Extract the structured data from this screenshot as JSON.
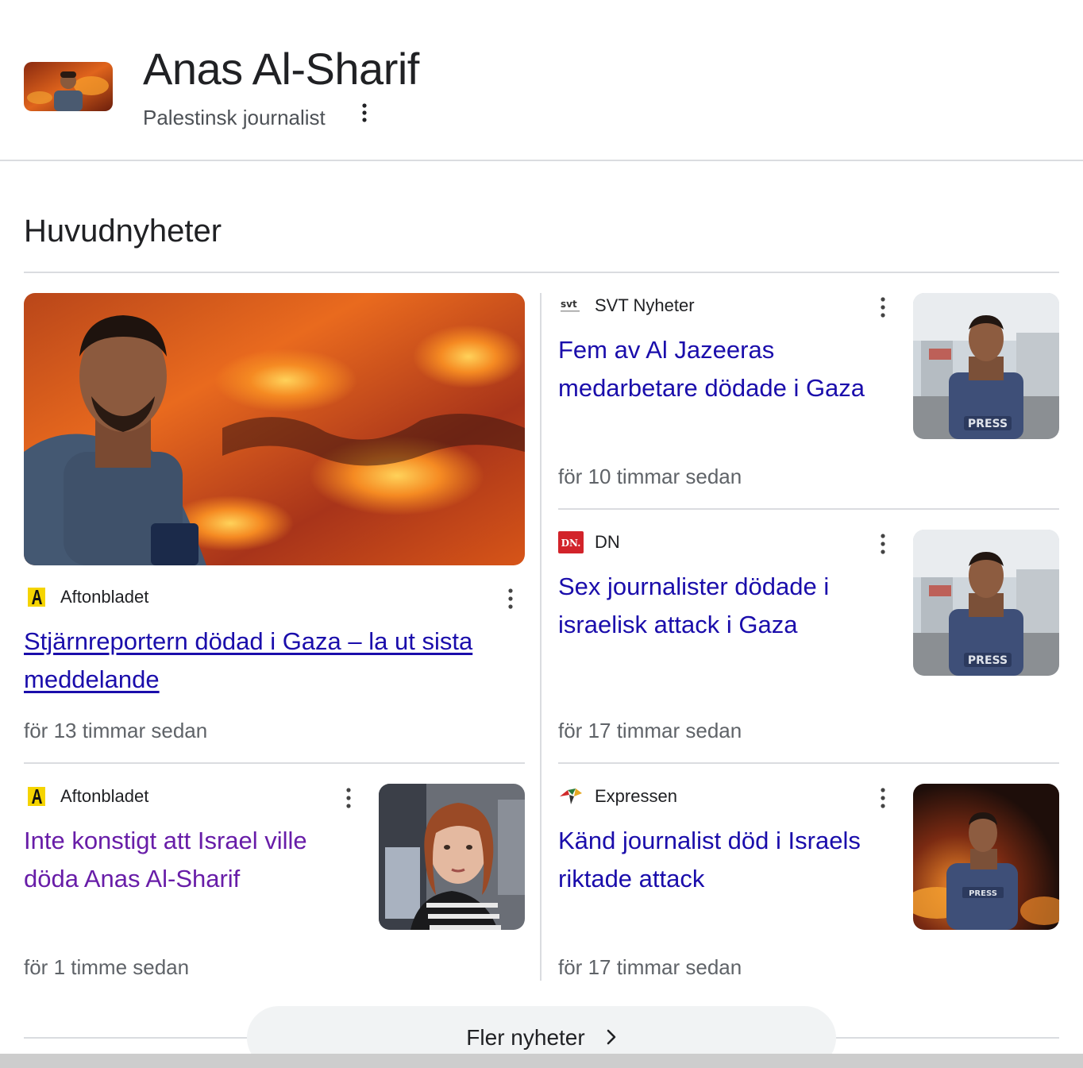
{
  "entity": {
    "title": "Anas Al-Sharif",
    "subtitle": "Palestinsk journalist"
  },
  "section": {
    "title": "Huvudnyheter"
  },
  "stories": [
    {
      "source": "Aftonbladet",
      "headline": "Stjärnreportern dödad i Gaza – la ut sista meddelande",
      "time": "för 13 timmar sedan"
    },
    {
      "source": "SVT Nyheter",
      "headline": "Fem av Al Jazeeras medarbetare dödade i Gaza",
      "time": "för 10 timmar sedan"
    },
    {
      "source": "DN",
      "headline": "Sex journalister dödade i israelisk attack i Gaza",
      "time": "för 17 timmar sedan"
    },
    {
      "source": "Aftonbladet",
      "headline": "Inte konstigt att Israel ville döda Anas Al-Sharif",
      "time": "för 1 timme sedan"
    },
    {
      "source": "Expressen",
      "headline": "Känd journalist död i Israels riktade attack",
      "time": "för 17 timmar sedan"
    }
  ],
  "more_button": {
    "label": "Fler nyheter"
  },
  "logos": {
    "svt": "svt",
    "dn": "DN."
  },
  "colors": {
    "link": "#1a0dab",
    "visited": "#681da8",
    "meta": "#5f6368",
    "divider": "#dadce0",
    "dn_red": "#d2232a",
    "aftonbladet_yellow": "#f5d400"
  },
  "icons": {
    "kebab": "more-vert-icon",
    "chevron": "chevron-right-icon"
  }
}
